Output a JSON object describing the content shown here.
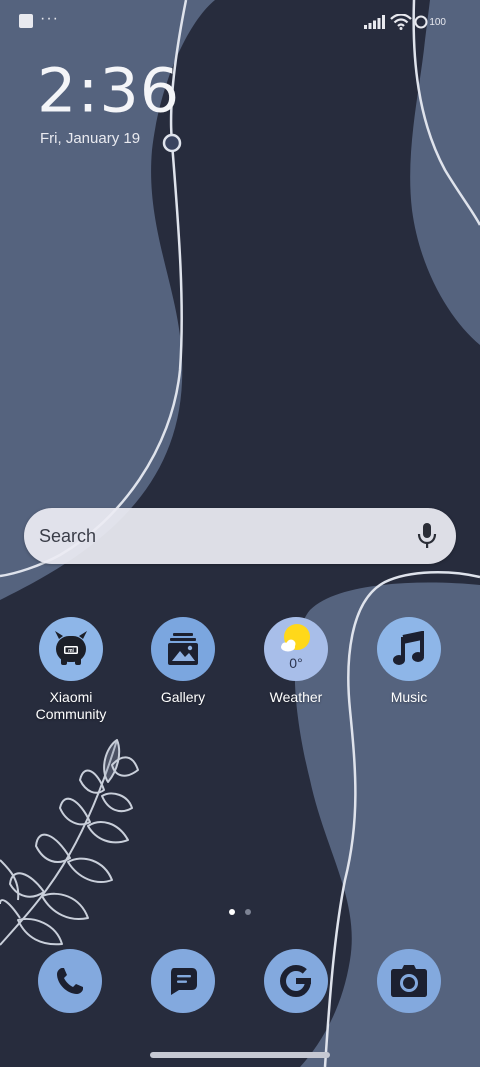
{
  "status_bar": {
    "overflow_dots": "···",
    "battery_level": "100",
    "icons": [
      "notification-square-icon",
      "signal-icon",
      "wifi-icon",
      "battery-icon"
    ]
  },
  "lockscreen_clock": {
    "time": "2:36",
    "date": "Fri, January 19"
  },
  "search": {
    "placeholder": "Search",
    "icon": "microphone-icon"
  },
  "apps": [
    {
      "label": "Xiaomi\nCommunity",
      "icon": "xiaomi-community-icon"
    },
    {
      "label": "Gallery",
      "icon": "gallery-icon"
    },
    {
      "label": "Weather",
      "icon": "weather-icon",
      "temperature": "0°"
    },
    {
      "label": "Music",
      "icon": "music-note-icon"
    }
  ],
  "page_indicator": {
    "pages": 2,
    "current": 1
  },
  "dock": [
    {
      "icon": "phone-icon"
    },
    {
      "icon": "messages-icon"
    },
    {
      "icon": "google-icon"
    },
    {
      "icon": "camera-icon"
    }
  ],
  "colors": {
    "background": "#272c3d",
    "wallpaper_shape": "#55637e",
    "app_icon_bg": "#8eb6e8",
    "dock_icon_bg": "#83a9de",
    "weather_sun": "#ffd81a"
  }
}
